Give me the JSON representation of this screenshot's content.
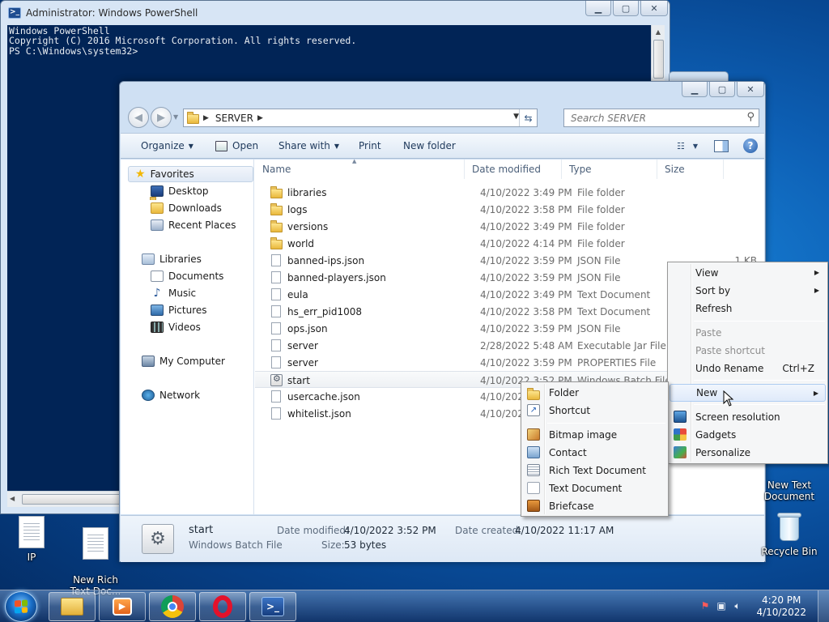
{
  "powershell": {
    "title": "Administrator: Windows PowerShell",
    "console_lines": [
      "Windows PowerShell",
      "Copyright (C) 2016 Microsoft Corporation. All rights reserved.",
      "",
      "PS C:\\Windows\\system32>"
    ]
  },
  "explorer": {
    "address_crumb": "SERVER",
    "search_placeholder": "Search SERVER",
    "toolbar": {
      "organize": "Organize",
      "open": "Open",
      "share_with": "Share with",
      "print": "Print",
      "new_folder": "New folder"
    },
    "nav": {
      "favorites": "Favorites",
      "desktop": "Desktop",
      "downloads": "Downloads",
      "recent_places": "Recent Places",
      "libraries": "Libraries",
      "documents": "Documents",
      "music": "Music",
      "pictures": "Pictures",
      "videos": "Videos",
      "my_computer": "My Computer",
      "network": "Network"
    },
    "columns": {
      "name": "Name",
      "date": "Date modified",
      "type": "Type",
      "size": "Size"
    },
    "files": [
      {
        "name": "libraries",
        "date": "4/10/2022 3:49 PM",
        "type": "File folder",
        "size": "",
        "icon": "folder"
      },
      {
        "name": "logs",
        "date": "4/10/2022 3:58 PM",
        "type": "File folder",
        "size": "",
        "icon": "folder"
      },
      {
        "name": "versions",
        "date": "4/10/2022 3:49 PM",
        "type": "File folder",
        "size": "",
        "icon": "folder"
      },
      {
        "name": "world",
        "date": "4/10/2022 4:14 PM",
        "type": "File folder",
        "size": "",
        "icon": "folder"
      },
      {
        "name": "banned-ips.json",
        "date": "4/10/2022 3:59 PM",
        "type": "JSON File",
        "size": "1 KB",
        "icon": "document"
      },
      {
        "name": "banned-players.json",
        "date": "4/10/2022 3:59 PM",
        "type": "JSON File",
        "size": "",
        "icon": "document"
      },
      {
        "name": "eula",
        "date": "4/10/2022 3:49 PM",
        "type": "Text Document",
        "size": "",
        "icon": "document"
      },
      {
        "name": "hs_err_pid1008",
        "date": "4/10/2022 3:58 PM",
        "type": "Text Document",
        "size": "",
        "icon": "document"
      },
      {
        "name": "ops.json",
        "date": "4/10/2022 3:59 PM",
        "type": "JSON File",
        "size": "",
        "icon": "document"
      },
      {
        "name": "server",
        "date": "2/28/2022 5:48 AM",
        "type": "Executable Jar File",
        "size": "",
        "icon": "document"
      },
      {
        "name": "server",
        "date": "4/10/2022 3:59 PM",
        "type": "PROPERTIES File",
        "size": "",
        "icon": "document"
      },
      {
        "name": "start",
        "date": "4/10/2022 3:52 PM",
        "type": "Windows Batch File",
        "size": "",
        "icon": "batch"
      },
      {
        "name": "usercache.json",
        "date": "4/10/2022",
        "type": "",
        "size": "",
        "icon": "document"
      },
      {
        "name": "whitelist.json",
        "date": "4/10/2022",
        "type": "",
        "size": "",
        "icon": "document"
      }
    ],
    "details": {
      "name": "start",
      "type": "Windows Batch File",
      "modified_label": "Date modified:",
      "modified_value": "4/10/2022 3:52 PM",
      "created_label": "Date created:",
      "created_value": "4/10/2022 11:17 AM",
      "size_label": "Size:",
      "size_value": "53 bytes"
    }
  },
  "context_menu": {
    "view": "View",
    "sort_by": "Sort by",
    "refresh": "Refresh",
    "paste": "Paste",
    "paste_shortcut": "Paste shortcut",
    "undo_rename": "Undo Rename",
    "undo_shortcut": "Ctrl+Z",
    "new": "New",
    "screen_resolution": "Screen resolution",
    "gadgets": "Gadgets",
    "personalize": "Personalize"
  },
  "new_submenu": {
    "folder": "Folder",
    "shortcut": "Shortcut",
    "bitmap": "Bitmap image",
    "contact": "Contact",
    "rich_text": "Rich Text Document",
    "text_doc": "Text Document",
    "briefcase": "Briefcase"
  },
  "desktop_icons": {
    "ip": "IP",
    "new_rich_text": "New Rich\nText Doc...",
    "new_text_doc": "New Text\nDocument",
    "recycle_bin": "Recycle Bin"
  },
  "clock": {
    "time": "4:20 PM",
    "date": "4/10/2022"
  }
}
